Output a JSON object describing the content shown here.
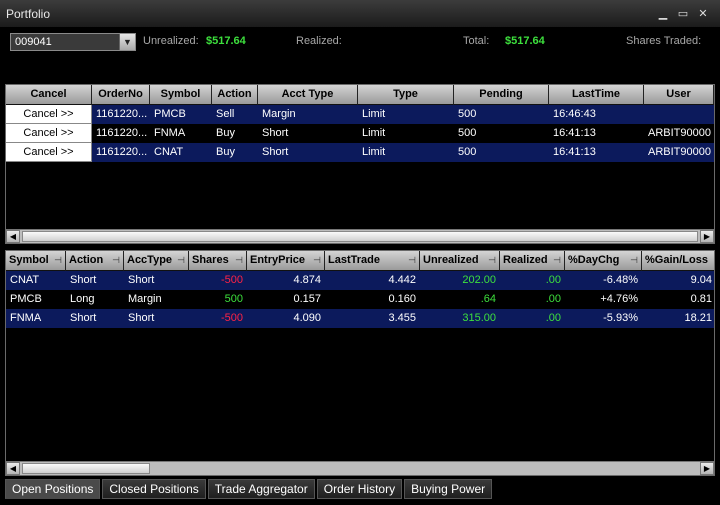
{
  "window": {
    "title": "Portfolio",
    "min": "▁",
    "max": "▭",
    "close": "✕"
  },
  "summary": {
    "account": "009041",
    "unrealized_label": "Unrealized:",
    "unrealized_value": "$517.64",
    "realized_label": "Realized:",
    "realized_value": "",
    "total_label": "Total:",
    "total_value": "$517.64",
    "shares_traded_label": "Shares Traded:",
    "shares_traded_value": ""
  },
  "orders": {
    "columns": [
      "Cancel",
      "OrderNo",
      "Symbol",
      "Action",
      "Acct Type",
      "Type",
      "Pending",
      "LastTime",
      "User"
    ],
    "rows": [
      {
        "cancel": "Cancel >>",
        "orderno": "1161220...",
        "symbol": "PMCB",
        "action": "Sell",
        "accttype": "Margin",
        "type": "Limit",
        "pending": "500",
        "lasttime": "16:46:43",
        "user": ""
      },
      {
        "cancel": "Cancel >>",
        "orderno": "1161220...",
        "symbol": "FNMA",
        "action": "Buy",
        "accttype": "Short",
        "type": "Limit",
        "pending": "500",
        "lasttime": "16:41:13",
        "user": "ARBIT90000"
      },
      {
        "cancel": "Cancel >>",
        "orderno": "1161220...",
        "symbol": "CNAT",
        "action": "Buy",
        "accttype": "Short",
        "type": "Limit",
        "pending": "500",
        "lasttime": "16:41:13",
        "user": "ARBIT90000"
      }
    ]
  },
  "positions": {
    "columns": [
      "Symbol",
      "Action",
      "AccType",
      "Shares",
      "EntryPrice",
      "LastTrade",
      "Unrealized",
      "Realized",
      "%DayChg",
      "%Gain/Loss"
    ],
    "rows": [
      {
        "symbol": "CNAT",
        "action": "Short",
        "acctype": "Short",
        "shares": "-500",
        "entry": "4.874",
        "last": "4.442",
        "unrealized": "202.00",
        "realized": ".00",
        "daychg": "-6.48%",
        "gainloss": "9.04"
      },
      {
        "symbol": "PMCB",
        "action": "Long",
        "acctype": "Margin",
        "shares": "500",
        "entry": "0.157",
        "last": "0.160",
        "unrealized": ".64",
        "realized": ".00",
        "daychg": "+4.76%",
        "gainloss": "0.81"
      },
      {
        "symbol": "FNMA",
        "action": "Short",
        "acctype": "Short",
        "shares": "-500",
        "entry": "4.090",
        "last": "3.455",
        "unrealized": "315.00",
        "realized": ".00",
        "daychg": "-5.93%",
        "gainloss": "18.21"
      }
    ]
  },
  "tabs": [
    "Open Positions",
    "Closed Positions",
    "Trade Aggregator",
    "Order History",
    "Buying Power"
  ],
  "colors": {
    "positive": "#3de03d",
    "negative": "#ff2244",
    "row_highlight": "#0c1a5c"
  },
  "icons": {
    "dropdown": "chevron-down-icon",
    "pin": "pin-icon",
    "scroll_left": "arrow-left-icon",
    "scroll_right": "arrow-right-icon"
  }
}
